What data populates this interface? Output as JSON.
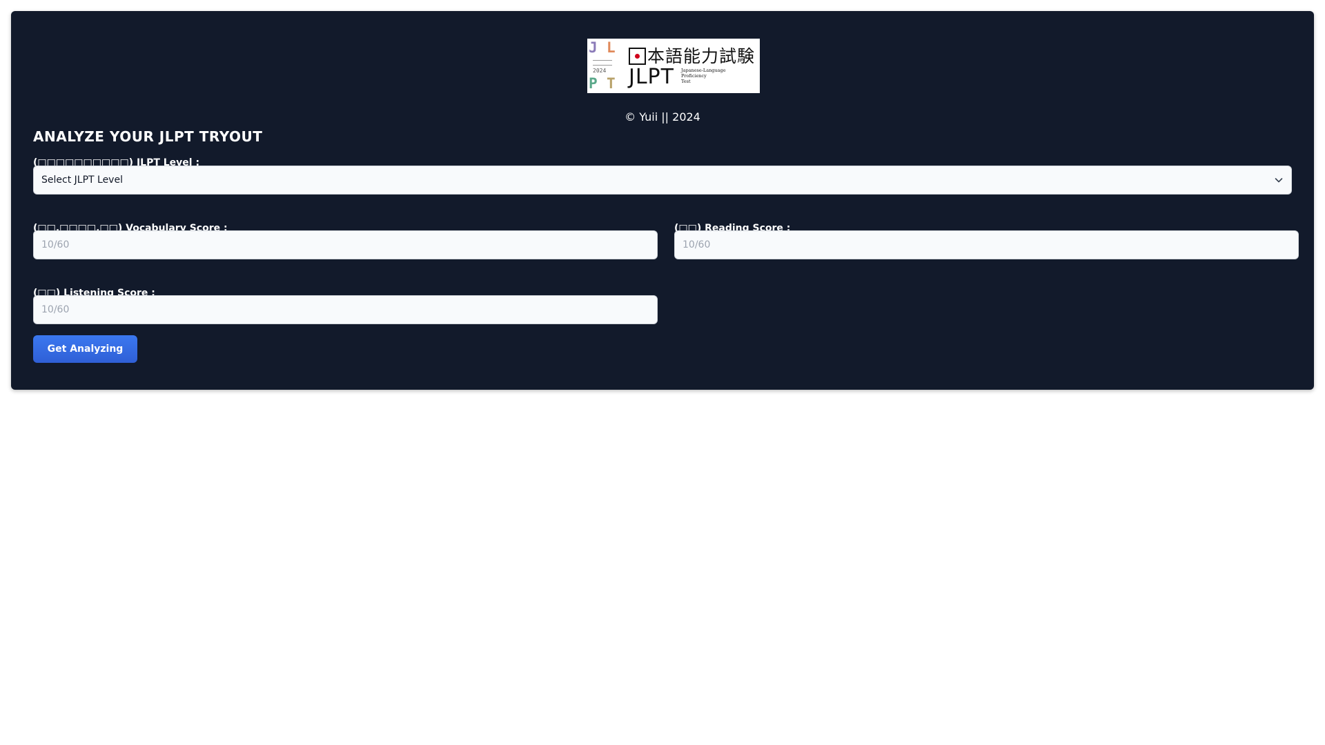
{
  "header": {
    "logo": {
      "letters": [
        "J",
        "L",
        "P",
        "T"
      ],
      "year": "2024",
      "jp_title": "本語能力試験",
      "jlpt": "JLPT",
      "subtitle_lines": [
        "Japanese-Language",
        "Proficiency",
        "Test"
      ]
    },
    "copyright": "© Yuii || 2024"
  },
  "form": {
    "title": "ANALYZE YOUR JLPT TRYOUT",
    "level": {
      "label": "(□□□□□□□□□□) JLPT Level :",
      "selected": "Select JLPT Level"
    },
    "vocabulary": {
      "label": "(□□.□□□□.□□) Vocabulary Score :",
      "placeholder": "10/60"
    },
    "reading": {
      "label": "(□□) Reading Score :",
      "placeholder": "10/60"
    },
    "listening": {
      "label": "(□□) Listening Score :",
      "placeholder": "10/60"
    },
    "submit_label": "Get Analyzing"
  },
  "colors": {
    "card_bg": "#121a2b",
    "accent": "#3b78f0",
    "logo_letters": [
      "#8b7bb8",
      "#e0895a",
      "#5aa88a",
      "#b8a26a"
    ]
  }
}
